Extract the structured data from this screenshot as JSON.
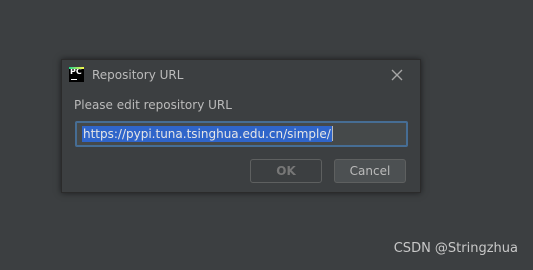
{
  "dialog": {
    "title": "Repository URL",
    "app_logo_text": "PC",
    "app_logo_icon": "pycharm-logo-icon",
    "close_icon": "close-icon",
    "prompt": "Please edit repository URL",
    "url_value": "https://pypi.tuna.tsinghua.edu.cn/simple/",
    "url_selected": true,
    "ok_label": "OK",
    "ok_enabled": false,
    "cancel_label": "Cancel"
  },
  "watermark": "CSDN @Stringzhua",
  "colors": {
    "background": "#3c3f41",
    "input_focus_border": "#466d94",
    "selection": "#2f65ca",
    "text": "#bbbbbb",
    "disabled_text": "#777777"
  }
}
